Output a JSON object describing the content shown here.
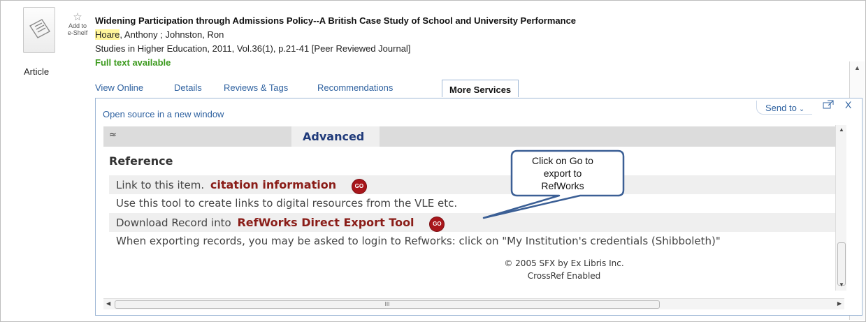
{
  "item": {
    "type_label": "Article",
    "eshelf_label_line1": "Add to",
    "eshelf_label_line2": "e-Shelf",
    "title": "Widening Participation through Admissions Policy--A British Case Study of School and University Performance",
    "author_highlight": "Hoare",
    "authors_rest": ", Anthony ; Johnston, Ron",
    "source": "Studies in Higher Education, 2011, Vol.36(1), p.21-41 [Peer Reviewed Journal]",
    "availability": "Full text available"
  },
  "tabs": [
    {
      "label": "View Online"
    },
    {
      "label": "Details"
    },
    {
      "label": "Reviews & Tags"
    },
    {
      "label": "Recommendations"
    },
    {
      "label": "More Services"
    }
  ],
  "panel": {
    "open_source_link": "Open source in a new window",
    "send_to": "Send to",
    "close": "X",
    "advanced_label": "Advanced",
    "reference_heading": "Reference",
    "link_item_prefix": "Link to this item.",
    "link_item_link": "citation information",
    "link_item_note": "Use this tool to create links to digital resources from the VLE etc.",
    "download_prefix": "Download Record into",
    "download_link": "RefWorks Direct Export Tool",
    "download_note": "When exporting records, you may be asked to login to Refworks: click on \"My Institution's credentials (Shibboleth)\"",
    "go_label": "GO",
    "footer_line1": "© 2005 SFX by Ex Libris Inc.",
    "footer_line2": "CrossRef Enabled",
    "hscroll_grip": "III"
  },
  "callout": {
    "line1": "Click on Go to",
    "line2": "export to",
    "line3": "RefWorks"
  },
  "colors": {
    "link": "#2f62a0",
    "link_dark": "#8a1d18",
    "go_button": "#a8161b",
    "full_text": "#3c9a1e",
    "highlight": "#fff59a"
  }
}
